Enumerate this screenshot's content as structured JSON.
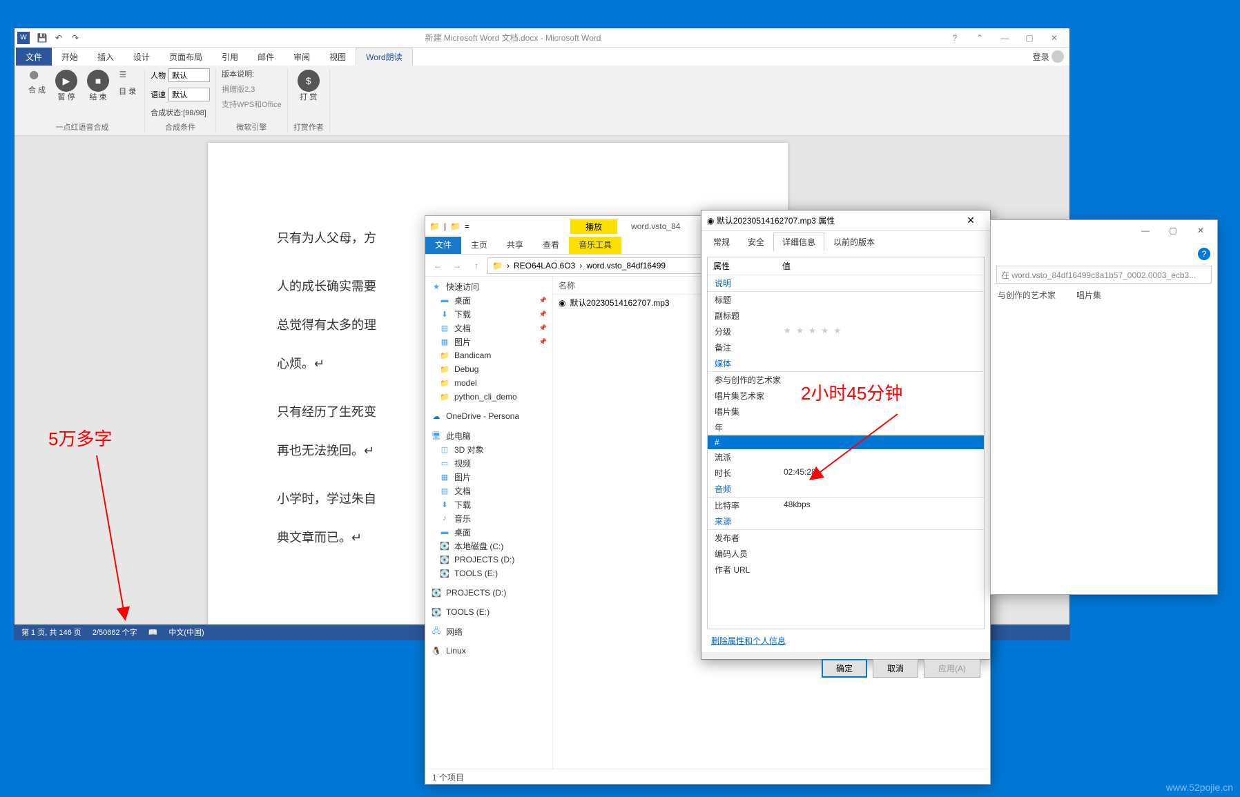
{
  "word": {
    "title": "新建 Microsoft Word 文档.docx - Microsoft Word",
    "help_btn": "?",
    "tabs": {
      "file": "文件",
      "home": "开始",
      "insert": "插入",
      "design": "设计",
      "layout": "页面布局",
      "references": "引用",
      "mailings": "邮件",
      "review": "审阅",
      "view": "视图",
      "addon": "Word朗读"
    },
    "user": "登录",
    "ribbon": {
      "g1_label": "一点红语音合成",
      "btn_synth": "合\n成",
      "btn_pause": "暂\n停",
      "btn_end": "结\n束",
      "btn_toc": "目\n录",
      "g2_label": "合成条件",
      "row1_label": "人物",
      "row1_val": "默认",
      "row2_label": "语速",
      "row2_val": "默认",
      "row3_text": "合成状态:[98/98]",
      "g3_label": "微软引擎",
      "g3_r1": "版本说明:",
      "g3_r2": "捐赠版2.3",
      "g3_r3": "支持WPS和Office",
      "g4_label": "打赏作者",
      "btn_reward": "打\n赏"
    },
    "doc": {
      "p1": "只有为人父母，方",
      "p2": "人的成长确实需要",
      "p3": "总觉得有太多的理",
      "p4": "心烦。↵",
      "p5": "只有经历了生死变",
      "p6": "再也无法挽回。↵",
      "p7": "小学时，学过朱自",
      "p8": "典文章而已。↵"
    },
    "status": {
      "page": "第 1 页, 共 146 页",
      "words": "2/50662 个字",
      "lang": "中文(中国)"
    }
  },
  "annotations": {
    "left": "5万多字",
    "right": "2小时45分钟"
  },
  "explorer": {
    "title": "word.vsto_84",
    "tabs": {
      "file": "文件",
      "home": "主页",
      "share": "共享",
      "view": "查看",
      "music": "音乐工具",
      "play": "播放"
    },
    "breadcrumb": {
      "b1": "REO64LAO.6O3",
      "b2": "word.vsto_84df16499"
    },
    "sidebar": {
      "quick": "快速访问",
      "desktop": "桌面",
      "downloads": "下载",
      "documents": "文档",
      "pictures": "图片",
      "f1": "Bandicam",
      "f2": "Debug",
      "f3": "model",
      "f4": "python_cli_demo",
      "onedrive": "OneDrive - Persona",
      "thispc": "此电脑",
      "obj3d": "3D 对象",
      "videos": "视频",
      "pics2": "图片",
      "docs2": "文档",
      "dl2": "下载",
      "music": "音乐",
      "desk2": "桌面",
      "disk_c": "本地磁盘 (C:)",
      "disk_d": "PROJECTS (D:)",
      "disk_e": "TOOLS (E:)",
      "proj_d": "PROJECTS (D:)",
      "tools_e": "TOOLS (E:)",
      "network": "网络",
      "linux": "Linux"
    },
    "col_name": "名称",
    "file1": "默认20230514162707.mp3",
    "status": "1 个项目"
  },
  "props": {
    "title": "默认20230514162707.mp3 属性",
    "tabs": {
      "general": "常规",
      "security": "安全",
      "details": "详细信息",
      "prev": "以前的版本"
    },
    "hdr_prop": "属性",
    "hdr_val": "值",
    "sect_desc": "说明",
    "r_title": "标题",
    "r_subtitle": "副标题",
    "r_rating": "分级",
    "r_comment": "备注",
    "sect_media": "媒体",
    "r_artists": "参与创作的艺术家",
    "r_albumartist": "唱片集艺术家",
    "r_album": "唱片集",
    "r_year": "年",
    "r_num": "#",
    "r_genre": "流派",
    "r_duration": "时长",
    "v_duration": "02:45:28",
    "sect_audio": "音频",
    "r_bitrate": "比特率",
    "v_bitrate": "48kbps",
    "sect_source": "来源",
    "r_publisher": "发布者",
    "r_encoder": "编码人员",
    "r_authorurl": "作者 URL",
    "link": "删除属性和个人信息",
    "btn_ok": "确定",
    "btn_cancel": "取消",
    "btn_apply": "应用(A)"
  },
  "search": {
    "placeholder": "在 word.vsto_84df16499c8a1b57_0002.0003_ecb3...",
    "col1": "与创作的艺术家",
    "col2": "唱片集"
  },
  "watermark": "www.52pojie.cn"
}
